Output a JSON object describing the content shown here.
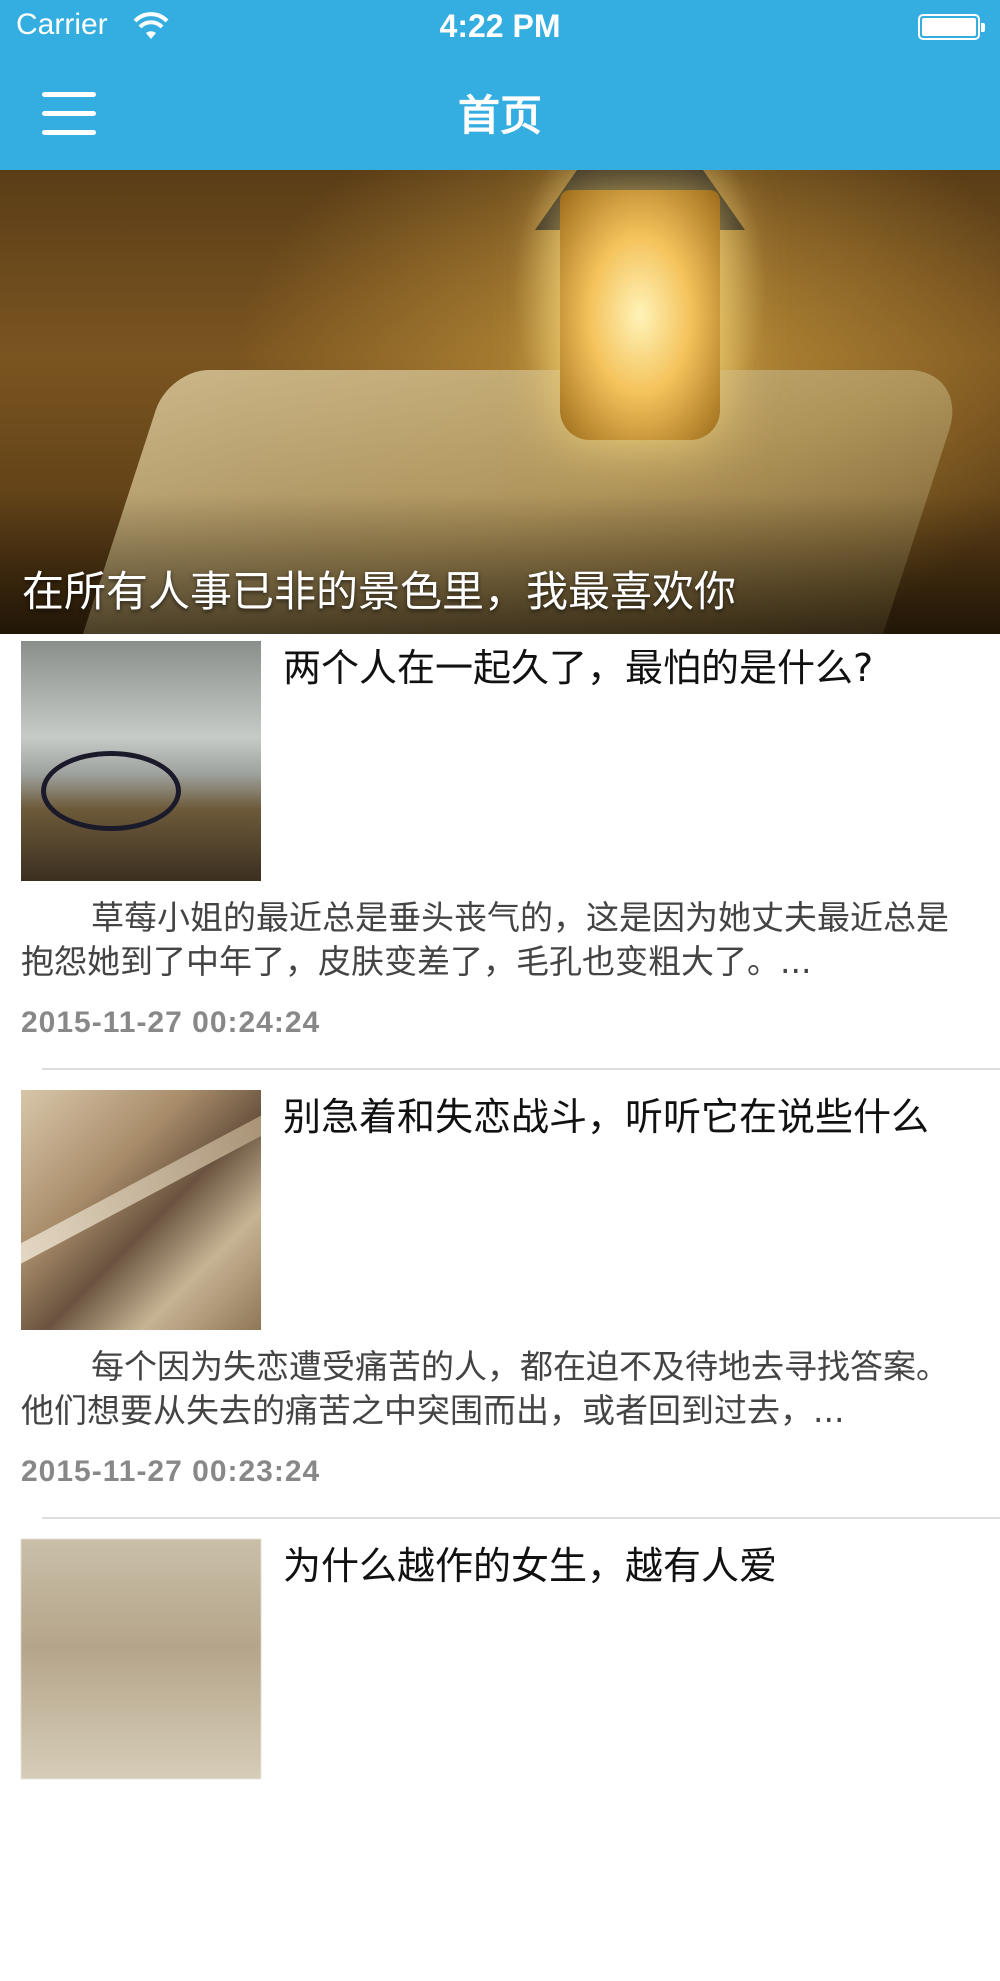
{
  "status_bar": {
    "carrier": "Carrier",
    "time": "4:22 PM",
    "battery_level": 1.0
  },
  "nav": {
    "title": "首页",
    "menu_icon": "hamburger-menu-icon",
    "background_color": "#34ade0"
  },
  "hero": {
    "caption": "在所有人事已非的景色里，我最喜欢你",
    "image": "lantern-and-open-book-photo"
  },
  "articles": [
    {
      "title": "两个人在一起久了，最怕的是什么?",
      "summary": "草莓小姐的最近总是垂头丧气的，这是因为她丈夫最近总是抱怨她到了中年了，皮肤变差了，毛孔也变粗大了。...",
      "date": "2015-11-27 00:24:24",
      "thumbnail": "bicycle-on-pier-photo"
    },
    {
      "title": "别急着和失恋战斗，听听它在说些什么",
      "summary": "每个因为失恋遭受痛苦的人，都在迫不及待地去寻找答案。他们想要从失去的痛苦之中突围而出，或者回到过去，...",
      "date": "2015-11-27 00:23:24",
      "thumbnail": "railway-track-photo"
    },
    {
      "title": "为什么越作的女生，越有人爱",
      "summary": "",
      "date": "",
      "thumbnail": "blurred-cup-photo"
    }
  ]
}
